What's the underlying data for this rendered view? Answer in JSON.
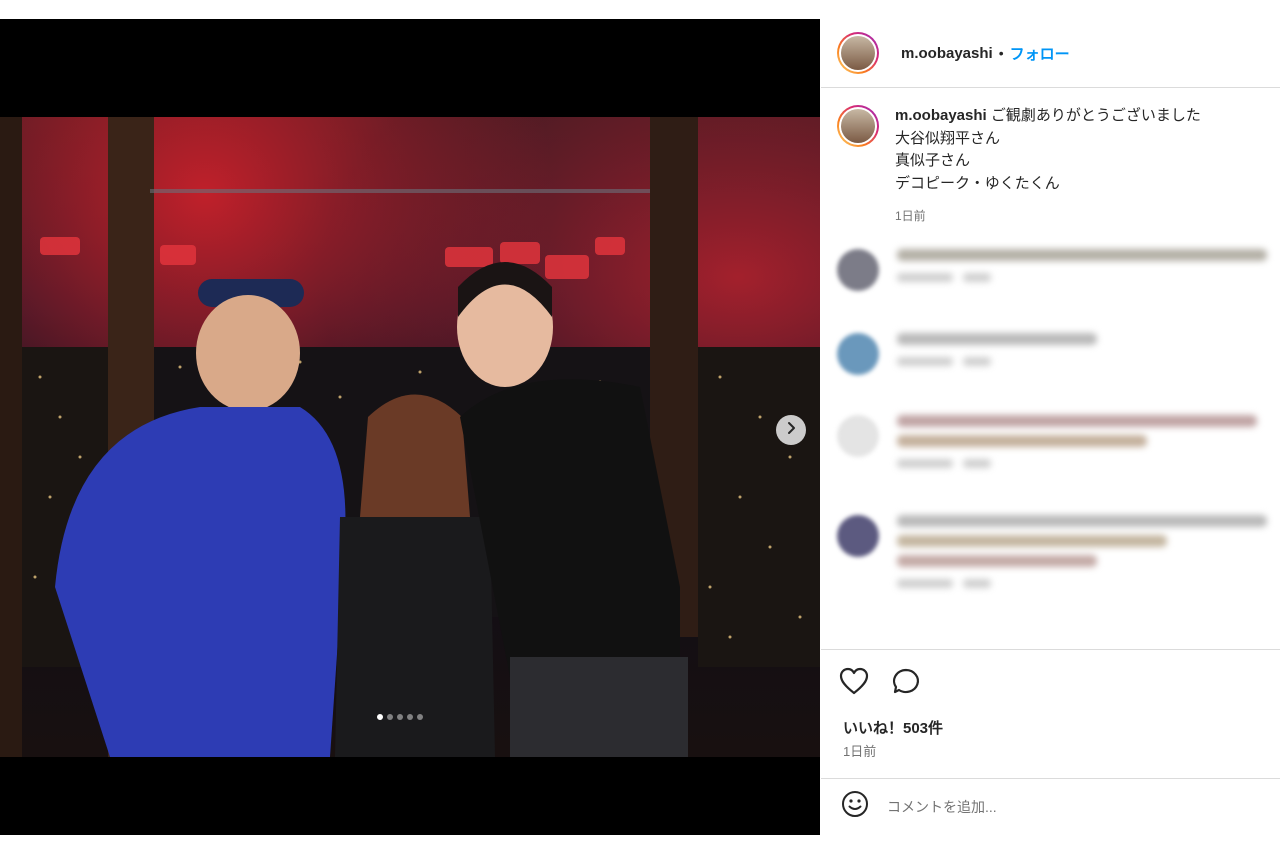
{
  "post": {
    "username": "m.oobayashi",
    "separator": "•",
    "follow_label": "フォロー",
    "caption_text": "ご観劇ありがとうございました",
    "caption_lines": [
      "大谷似翔平さん",
      "真似子さん",
      "デコピーク・ゆくたくん"
    ],
    "caption_time": "1日前",
    "likes_label": "いいね！503件",
    "time_label": "1日前",
    "comment_placeholder": "コメントを追加...",
    "carousel_total": 5,
    "carousel_index": 1
  },
  "icons": {
    "like": "heart-outline-icon",
    "comment": "speech-bubble-icon",
    "emoji": "smiley-icon",
    "next": "chevron-right-icon"
  },
  "colors": {
    "accent": "#0095f6",
    "ring_gradient": [
      "#feda75",
      "#fa7e1e",
      "#d62976",
      "#962fbf"
    ],
    "text": "#262626",
    "muted": "#737373",
    "border": "#dbdbdb"
  }
}
